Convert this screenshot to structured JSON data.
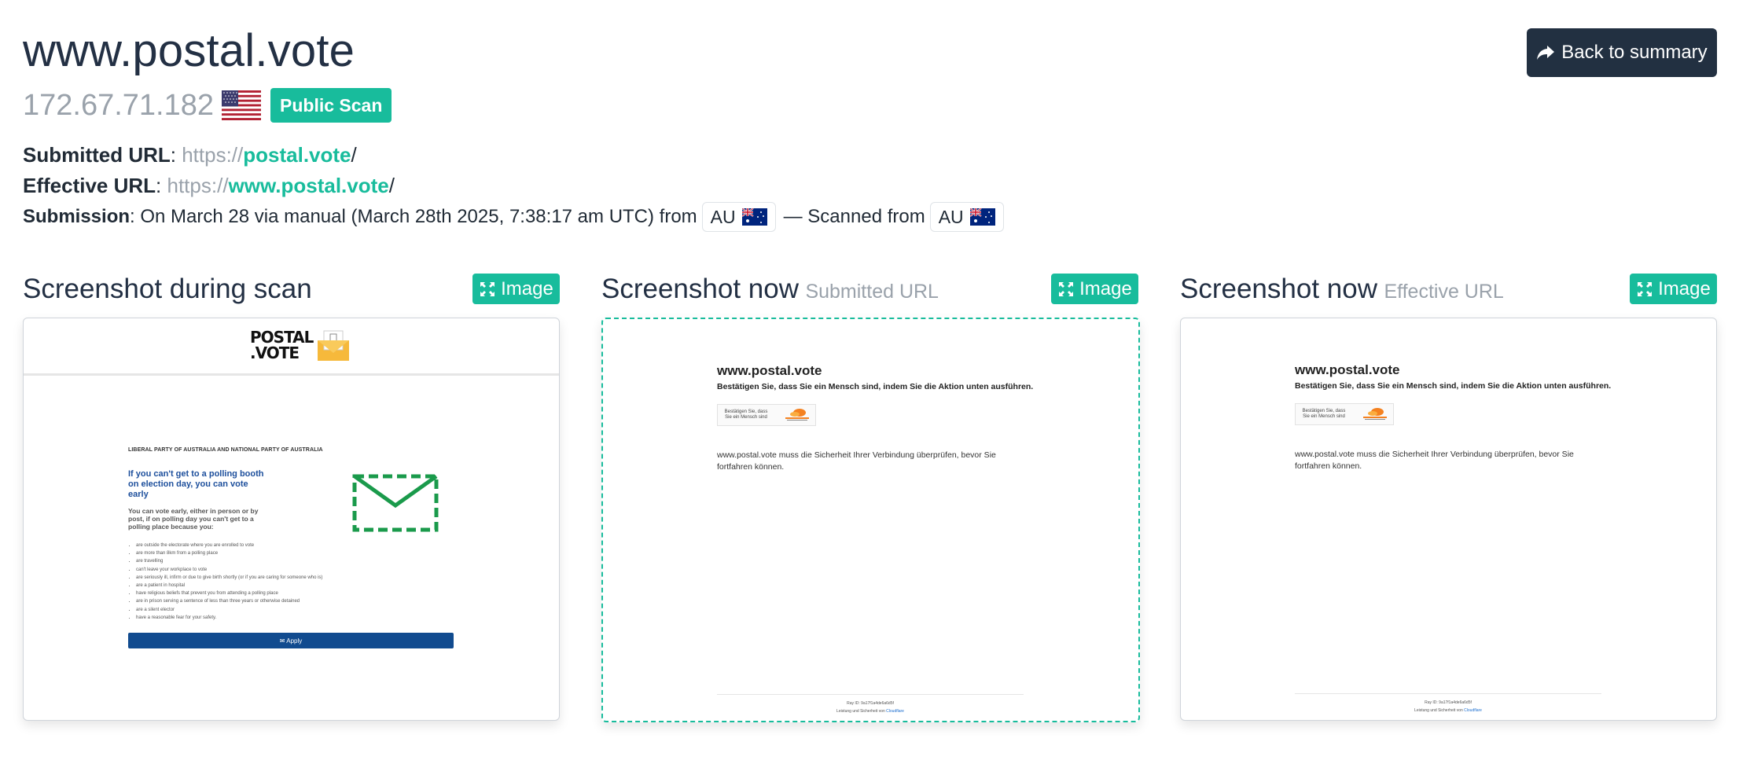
{
  "header": {
    "title": "www.postal.vote",
    "back_button_label": "Back to summary",
    "ip": "172.67.71.182",
    "badge": "Public Scan"
  },
  "urls": {
    "submitted_label": "Submitted URL",
    "submitted_scheme": "https://",
    "submitted_host": "postal.vote",
    "submitted_path": "/",
    "effective_label": "Effective URL",
    "effective_scheme": "https://",
    "effective_host": "www.postal.vote",
    "effective_path": "/"
  },
  "submission": {
    "label": "Submission",
    "text": ": On March 28 via manual (March 28th 2025, 7:38:17 am UTC) from",
    "from_cc": "AU",
    "scanned_text": "— Scanned from",
    "scanned_cc": "AU"
  },
  "panels": [
    {
      "title": "Screenshot during scan",
      "subtitle": "",
      "button": "Image"
    },
    {
      "title": "Screenshot now",
      "subtitle": "Submitted URL",
      "button": "Image"
    },
    {
      "title": "Screenshot now",
      "subtitle": "Effective URL",
      "button": "Image"
    }
  ],
  "shot1": {
    "logo_line1": "POSTAL",
    "logo_line2": ".VOTE",
    "party": "LIBERAL PARTY OF AUSTRALIA AND NATIONAL PARTY OF AUSTRALIA",
    "heading": "If you can't get to a polling booth on election day, you can vote early",
    "subheading": "You can vote early, either in person or by post, if on polling day you can't get to a polling place because you:",
    "list": [
      "are outside the electorate where you are enrolled to vote",
      "are more than 8km from a polling place",
      "are travelling",
      "can't leave your workplace to vote",
      "are seriously ill, infirm or due to give birth shortly (or if you are caring for someone who is)",
      "are a patient in hospital",
      "have religious beliefs that prevent you from attending a polling place",
      "are in prison serving a sentence of less than three years or otherwise detained",
      "are a silent elector",
      "have a reasonable fear for your safety."
    ],
    "apply": "✉ Apply"
  },
  "cloudflare": {
    "host": "www.postal.vote",
    "confirm": "Bestätigen Sie, dass Sie ein Mensch sind, indem Sie die Aktion unten ausführen.",
    "box_text": "Bestätigen Sie, dass Sie ein Mensch sind",
    "logo_text": "CLOUDFLARE",
    "desc": "www.postal.vote muss die Sicherheit Ihrer Verbindung überprüfen, bevor Sie fortfahren können.",
    "ray": "Ray ID: 9a17f1a4de6a6d5f",
    "perf_prefix": "Leistung und Sicherheit von ",
    "perf_link": "Cloudflare"
  },
  "colors": {
    "accent": "#18bc9c",
    "dark": "#223041",
    "muted": "#9aa2ab"
  }
}
